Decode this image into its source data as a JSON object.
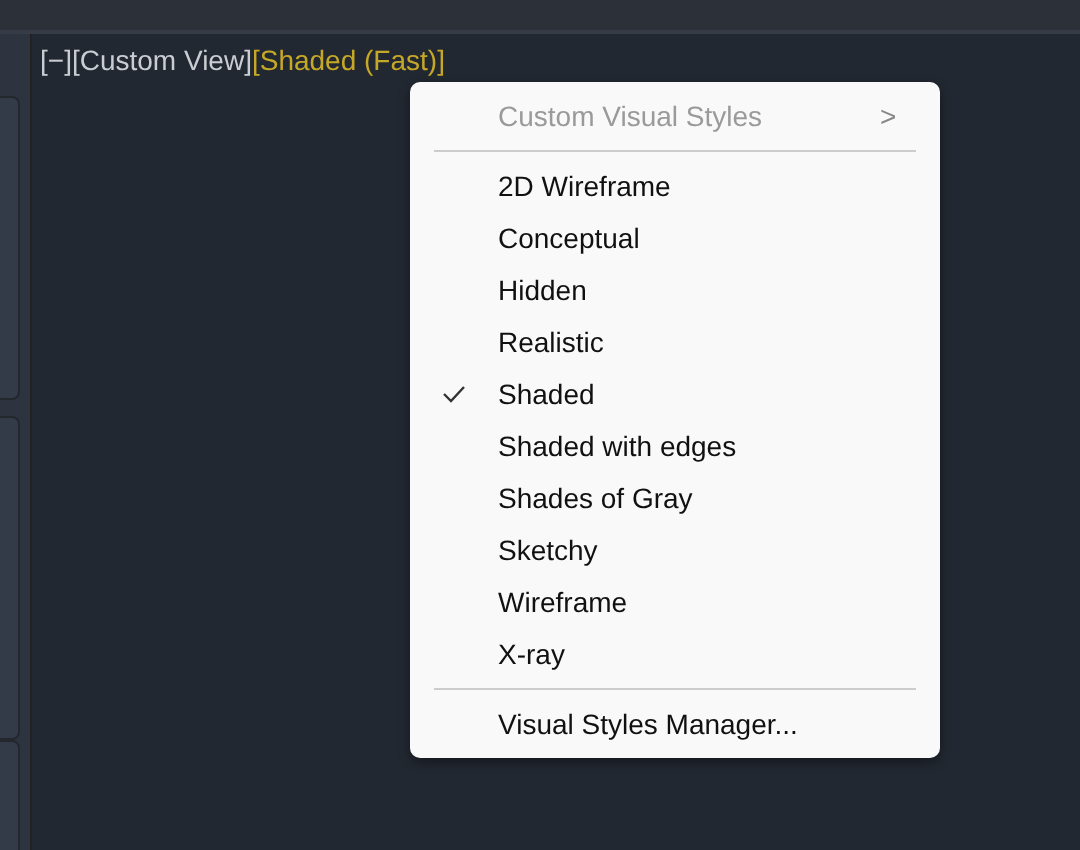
{
  "viewport_label": {
    "parts": [
      {
        "text": "[−]",
        "kind": "control"
      },
      {
        "text": "[Custom View]",
        "kind": "control"
      },
      {
        "text": "[Shaded (Fast)]",
        "kind": "highlight"
      }
    ]
  },
  "side_tabs": [
    {
      "selected": false
    },
    {
      "selected": false
    },
    {
      "selected": false
    }
  ],
  "context_menu": {
    "items": [
      {
        "kind": "submenu",
        "label": "Custom Visual Styles",
        "arrow": ">",
        "disabled": true
      },
      {
        "kind": "separator"
      },
      {
        "kind": "item",
        "label": "2D Wireframe",
        "checked": false
      },
      {
        "kind": "item",
        "label": "Conceptual",
        "checked": false
      },
      {
        "kind": "item",
        "label": "Hidden",
        "checked": false
      },
      {
        "kind": "item",
        "label": "Realistic",
        "checked": false
      },
      {
        "kind": "item",
        "label": "Shaded",
        "checked": true
      },
      {
        "kind": "item",
        "label": "Shaded with edges",
        "checked": false
      },
      {
        "kind": "item",
        "label": "Shades of Gray",
        "checked": false
      },
      {
        "kind": "item",
        "label": "Sketchy",
        "checked": false
      },
      {
        "kind": "item",
        "label": "Wireframe",
        "checked": false
      },
      {
        "kind": "item",
        "label": "X-ray",
        "checked": false
      },
      {
        "kind": "separator"
      },
      {
        "kind": "item",
        "label": "Visual Styles Manager...",
        "checked": false
      }
    ]
  }
}
